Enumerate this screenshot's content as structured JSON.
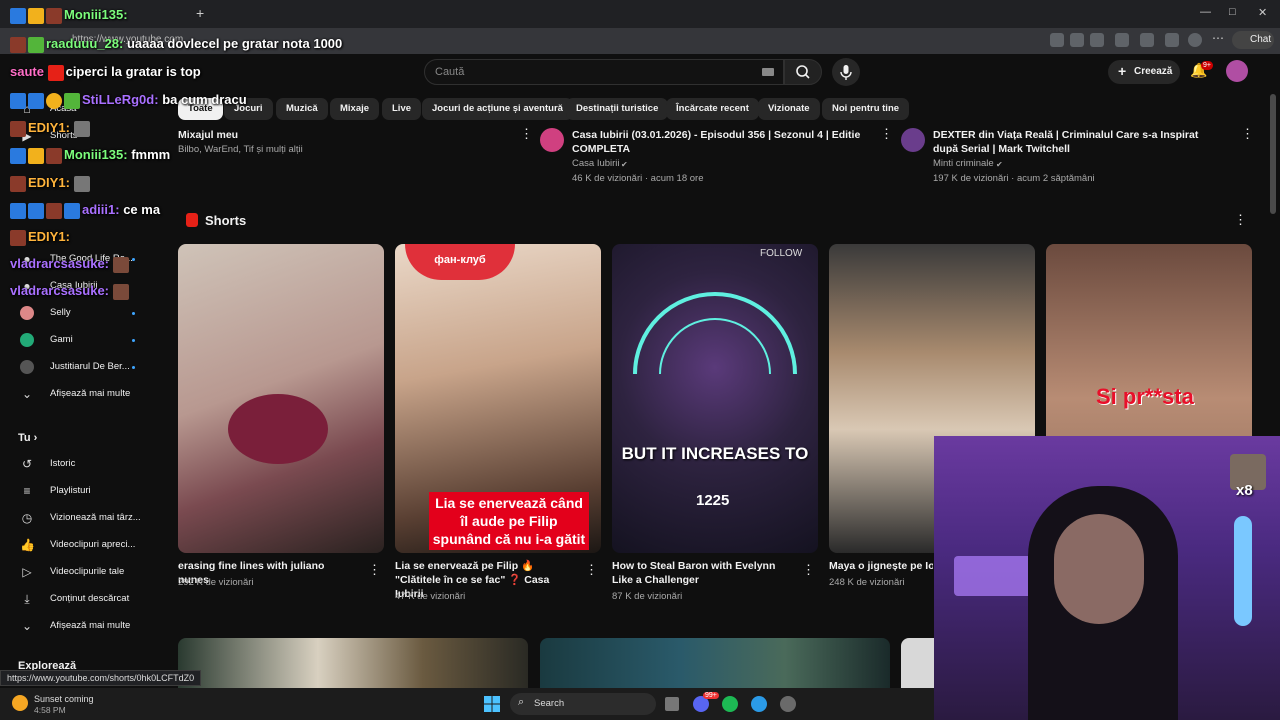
{
  "browser": {
    "url": "https://www.youtube.com",
    "status_url": "https://www.youtube.com/shorts/0hk0LCFTdZ0",
    "chat_button": "Chat",
    "window_controls": [
      "—",
      "□",
      "✕"
    ]
  },
  "header": {
    "search_placeholder": "Caută",
    "create_label": "Creează",
    "notif_count": "9+"
  },
  "chips": [
    "Toate",
    "Jocuri",
    "Muzică",
    "Mixaje",
    "Live",
    "Jocuri de acțiune și aventură",
    "Destinații turistice",
    "Încărcate recent",
    "Vizionate",
    "Noi pentru tine"
  ],
  "sidebar": {
    "top_items": [
      "Acasă",
      "Shorts"
    ],
    "subscriptions": [
      "The Good Life Ro...",
      "Casa Iubirii",
      "Selly",
      "Gami",
      "Justitiarul De Ber...",
      "Afișează mai multe"
    ],
    "you_heading": "Tu",
    "you_items": [
      "Istoric",
      "Playlisturi",
      "Vizionează mai târz...",
      "Videoclipuri apreci...",
      "Videoclipurile tale",
      "Conținut descărcat",
      "Afișează mai multe"
    ],
    "explore_heading": "Explorează"
  },
  "top_videos": [
    {
      "title": "Mixajul meu",
      "meta": "Bilbo, WarEnd, Tif și mulți alții"
    },
    {
      "title": "Casa Iubirii (03.01.2026) - Episodul 356 | Sezonul 4 | Editie COMPLETA",
      "channel": "Casa Iubirii",
      "meta": "46 K de vizionări · acum 18 ore"
    },
    {
      "title": "DEXTER din Viața Reală | Criminalul Care s-a Inspirat după Serial | Mark Twitchell",
      "channel": "Minti criminale",
      "meta": "197 K de vizionări · acum 2 săptămâni"
    }
  ],
  "shorts_heading": "Shorts",
  "shorts": [
    {
      "title": "erasing fine lines with juliano nunes",
      "views": "292 K de vizionări",
      "overlay": ""
    },
    {
      "title": "Lia se enervează pe Filip 🔥 \"Clătitele în ce se fac\" ❓ Casa Iubirii",
      "views": "47 K de vizionări",
      "overlay": "Lia se enervează când îl aude pe Filip spunând că nu i-a gătit",
      "sticker": "фан-клуб"
    },
    {
      "title": "How to Steal Baron with Evelynn Like a Challenger",
      "views": "87 K de vizionări",
      "overlay": "BUT IT INCREASES TO",
      "overlay2": "1225",
      "follow": "FOLLOW"
    },
    {
      "title": "Maya o jignește pe Ion",
      "views": "248 K de vizionări",
      "overlay": ""
    },
    {
      "title": "",
      "views": "",
      "overlay": "Si pr**sta"
    }
  ],
  "chat": [
    {
      "user": "Moniii135:",
      "msg": ""
    },
    {
      "user": "raaduuu_28:",
      "msg": "uaaaa dovlecel pe gratar nota 1000"
    },
    {
      "user": "saute",
      "msg": "ciperci la gratar is top"
    },
    {
      "user": "StiLLeRg0d:",
      "msg": "ba cum dracu"
    },
    {
      "user": "EDIY1:",
      "msg": ""
    },
    {
      "user": "Moniii135:",
      "msg": "fmmm"
    },
    {
      "user": "EDIY1:",
      "msg": ""
    },
    {
      "user": "adiii1:",
      "msg": "ce ma"
    },
    {
      "user": "EDIY1:",
      "msg": ""
    },
    {
      "user": "vladrarcsasuke:",
      "msg": ""
    },
    {
      "user": "vladrarcsasuke:",
      "msg": ""
    }
  ],
  "cam_overlay": "x8",
  "taskbar": {
    "weather_title": "Sunset coming",
    "time": "4:58 PM",
    "search_label": "Search",
    "notif_badge": "99+"
  }
}
